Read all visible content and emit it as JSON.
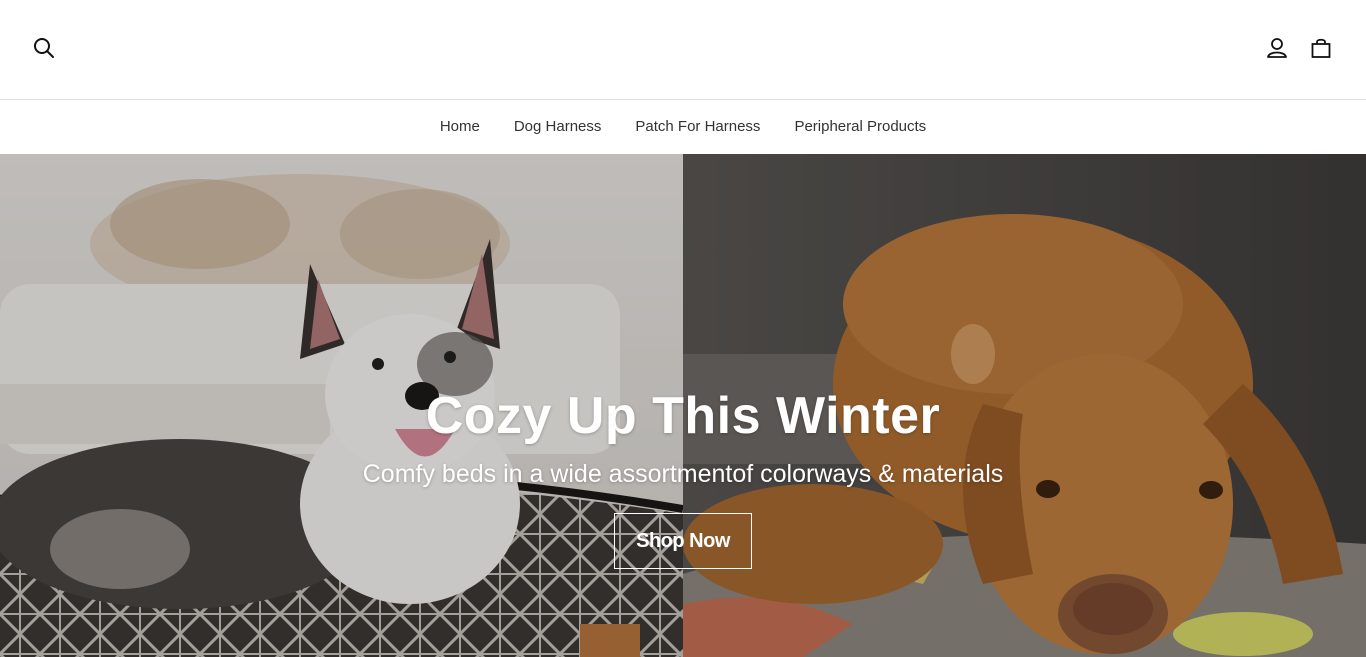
{
  "header": {
    "icons": {
      "search": "search-icon",
      "account": "account-icon",
      "cart": "shopping-bag-icon"
    }
  },
  "nav": {
    "items": [
      {
        "label": "Home"
      },
      {
        "label": "Dog Harness"
      },
      {
        "label": "Patch For Harness"
      },
      {
        "label": "Peripheral Products"
      }
    ]
  },
  "hero": {
    "title": "Cozy Up This Winter",
    "subtitle": "Comfy beds in a wide assortmentof colorways & materials",
    "cta_label": "Shop Now"
  },
  "colors": {
    "header_bg": "#ffffff",
    "nav_text": "#333333",
    "hero_text": "#ffffff"
  }
}
